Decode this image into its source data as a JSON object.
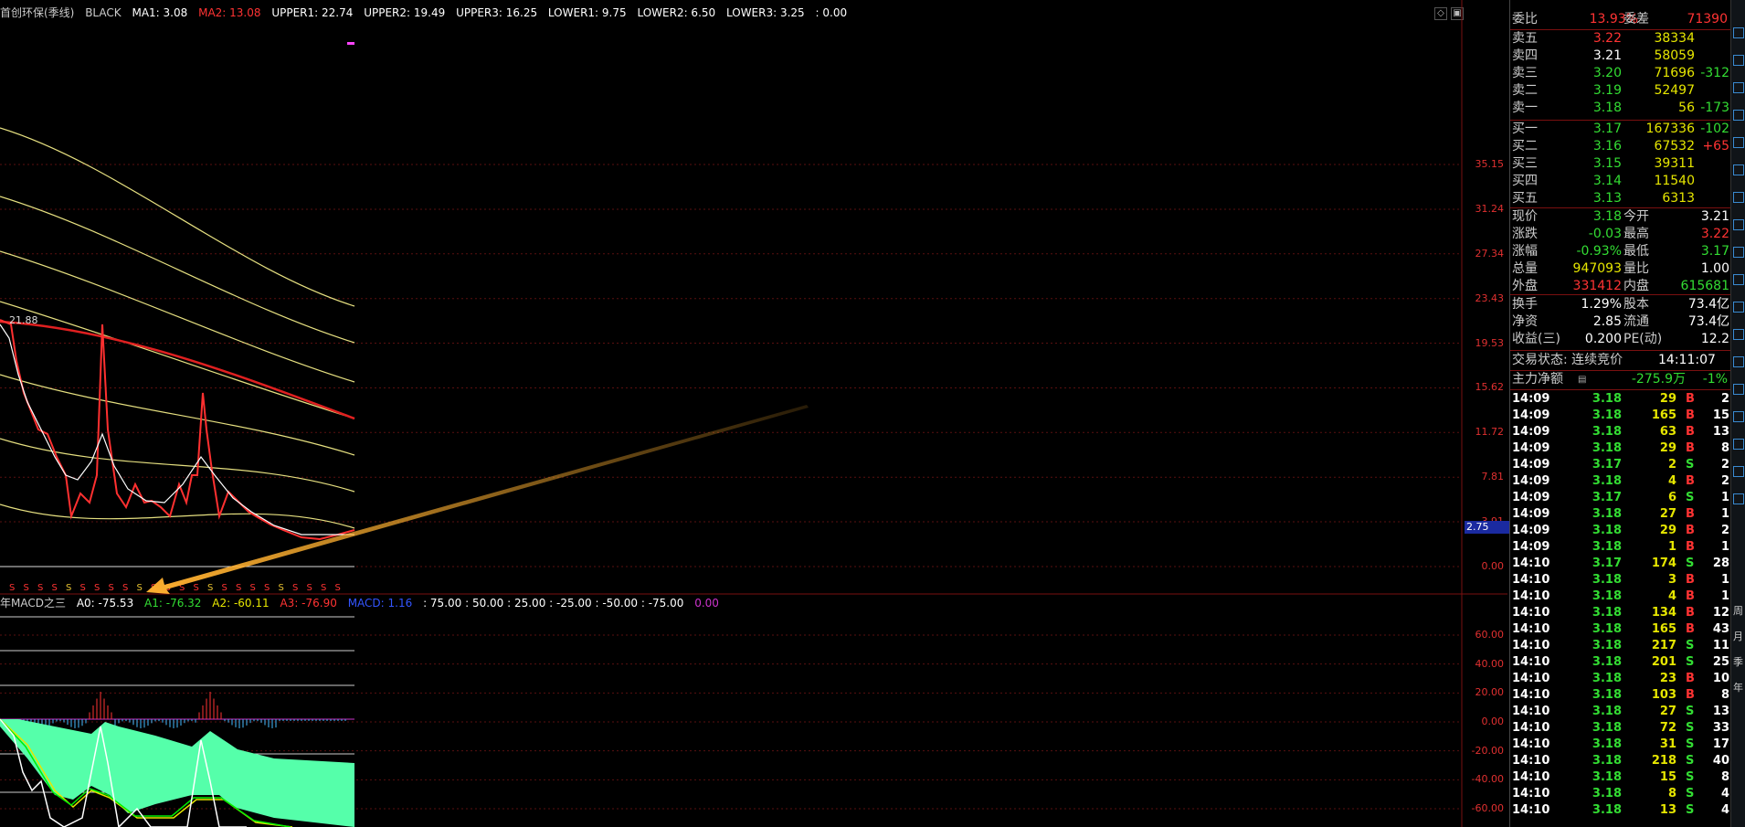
{
  "main_header": {
    "title": "首创环保(季线)",
    "style": "BLACK",
    "ma1": "MA1: 3.08",
    "ma2": "MA2: 13.08",
    "upper1": "UPPER1: 22.74",
    "upper2": "UPPER2: 19.49",
    "upper3": "UPPER3: 16.25",
    "lower1": "LOWER1: 9.75",
    "lower2": "LOWER2: 6.50",
    "lower3": "LOWER3: 3.25",
    "extra": ": 0.00"
  },
  "main_axis": [
    "35.15",
    "31.24",
    "27.34",
    "23.43",
    "19.53",
    "15.62",
    "11.72",
    "7.81",
    "3.91",
    "0.00"
  ],
  "current_price_marker": "2.75",
  "peak_label": "21.88",
  "macd_header": {
    "title": "年MACD之三",
    "a0": "A0: -75.53",
    "a1": "A1: -76.32",
    "a2": "A2: -60.11",
    "a3": "A3: -76.90",
    "macd": "MACD: 1.16",
    "levels": ": 75.00 : 50.00 : 25.00 : -25.00 : -50.00 : -75.00",
    "zero": "0.00"
  },
  "macd_axis": [
    "60.00",
    "40.00",
    "20.00",
    "0.00",
    "-20.00",
    "-40.00",
    "-60.00"
  ],
  "quote": {
    "weibi_label": "委比",
    "weibi": "13.93%",
    "weicha_label": "委差",
    "weicha": "71390",
    "asks": [
      {
        "label": "卖五",
        "price": "3.22",
        "vol": "38334",
        "chg": ""
      },
      {
        "label": "卖四",
        "price": "3.21",
        "vol": "58059",
        "chg": ""
      },
      {
        "label": "卖三",
        "price": "3.20",
        "vol": "71696",
        "chg": "-312"
      },
      {
        "label": "卖二",
        "price": "3.19",
        "vol": "52497",
        "chg": ""
      },
      {
        "label": "卖一",
        "price": "3.18",
        "vol": "56",
        "chg": "-173"
      }
    ],
    "bids": [
      {
        "label": "买一",
        "price": "3.17",
        "vol": "167336",
        "chg": "-102"
      },
      {
        "label": "买二",
        "price": "3.16",
        "vol": "67532",
        "chg": "+65"
      },
      {
        "label": "买三",
        "price": "3.15",
        "vol": "39311",
        "chg": ""
      },
      {
        "label": "买四",
        "price": "3.14",
        "vol": "11540",
        "chg": ""
      },
      {
        "label": "买五",
        "price": "3.13",
        "vol": "6313",
        "chg": ""
      }
    ],
    "stats": [
      {
        "l1": "现价",
        "v1": "3.18",
        "l2": "今开",
        "v2": "3.21"
      },
      {
        "l1": "涨跌",
        "v1": "-0.03",
        "l2": "最高",
        "v2": "3.22"
      },
      {
        "l1": "涨幅",
        "v1": "-0.93%",
        "l2": "最低",
        "v2": "3.17"
      },
      {
        "l1": "总量",
        "v1": "947093",
        "l2": "量比",
        "v2": "1.00"
      },
      {
        "l1": "外盘",
        "v1": "331412",
        "l2": "内盘",
        "v2": "615681"
      }
    ],
    "stats2": [
      {
        "l1": "换手",
        "v1": "1.29%",
        "l2": "股本",
        "v2": "73.4亿"
      },
      {
        "l1": "净资",
        "v1": "2.85",
        "l2": "流通",
        "v2": "73.4亿"
      },
      {
        "l1": "收益(三)",
        "v1": "0.200",
        "l2": "PE(动)",
        "v2": "12.2"
      }
    ],
    "trade_status": "交易状态: 连续竞价",
    "trade_time": "14:11:07",
    "main_flow_label": "主力净额",
    "main_flow": "-275.9万",
    "main_flow_pct": "-1%"
  },
  "ticks": [
    {
      "t": "14:09",
      "p": "3.18",
      "v": "29",
      "s": "B",
      "n": "2"
    },
    {
      "t": "14:09",
      "p": "3.18",
      "v": "165",
      "s": "B",
      "n": "15"
    },
    {
      "t": "14:09",
      "p": "3.18",
      "v": "63",
      "s": "B",
      "n": "13"
    },
    {
      "t": "14:09",
      "p": "3.18",
      "v": "29",
      "s": "B",
      "n": "8"
    },
    {
      "t": "14:09",
      "p": "3.17",
      "v": "2",
      "s": "S",
      "n": "2"
    },
    {
      "t": "14:09",
      "p": "3.18",
      "v": "4",
      "s": "B",
      "n": "2"
    },
    {
      "t": "14:09",
      "p": "3.17",
      "v": "6",
      "s": "S",
      "n": "1"
    },
    {
      "t": "14:09",
      "p": "3.18",
      "v": "27",
      "s": "B",
      "n": "1"
    },
    {
      "t": "14:09",
      "p": "3.18",
      "v": "29",
      "s": "B",
      "n": "2"
    },
    {
      "t": "14:09",
      "p": "3.18",
      "v": "1",
      "s": "B",
      "n": "1"
    },
    {
      "t": "14:10",
      "p": "3.17",
      "v": "174",
      "s": "S",
      "n": "28"
    },
    {
      "t": "14:10",
      "p": "3.18",
      "v": "3",
      "s": "B",
      "n": "1"
    },
    {
      "t": "14:10",
      "p": "3.18",
      "v": "4",
      "s": "B",
      "n": "1"
    },
    {
      "t": "14:10",
      "p": "3.18",
      "v": "134",
      "s": "B",
      "n": "12"
    },
    {
      "t": "14:10",
      "p": "3.18",
      "v": "165",
      "s": "B",
      "n": "43"
    },
    {
      "t": "14:10",
      "p": "3.18",
      "v": "217",
      "s": "S",
      "n": "11"
    },
    {
      "t": "14:10",
      "p": "3.18",
      "v": "201",
      "s": "S",
      "n": "25"
    },
    {
      "t": "14:10",
      "p": "3.18",
      "v": "23",
      "s": "B",
      "n": "10"
    },
    {
      "t": "14:10",
      "p": "3.18",
      "v": "103",
      "s": "B",
      "n": "8"
    },
    {
      "t": "14:10",
      "p": "3.18",
      "v": "27",
      "s": "S",
      "n": "13"
    },
    {
      "t": "14:10",
      "p": "3.18",
      "v": "72",
      "s": "S",
      "n": "33"
    },
    {
      "t": "14:10",
      "p": "3.18",
      "v": "31",
      "s": "S",
      "n": "17"
    },
    {
      "t": "14:10",
      "p": "3.18",
      "v": "218",
      "s": "S",
      "n": "40"
    },
    {
      "t": "14:10",
      "p": "3.18",
      "v": "15",
      "s": "S",
      "n": "8"
    },
    {
      "t": "14:10",
      "p": "3.18",
      "v": "8",
      "s": "S",
      "n": "4"
    },
    {
      "t": "14:10",
      "p": "3.18",
      "v": "13",
      "s": "S",
      "n": "4"
    }
  ],
  "side_glyphs": [
    "周",
    "月",
    "季",
    "年"
  ],
  "colors": {
    "up": "#ff3333",
    "down": "#33dd33",
    "price_line": "#ff3030",
    "ma_line": "#ffffff",
    "band": "#e6e080",
    "ma2": "#e02020",
    "macd_fill": "#55ffaa",
    "arrow": "#ffb030"
  }
}
